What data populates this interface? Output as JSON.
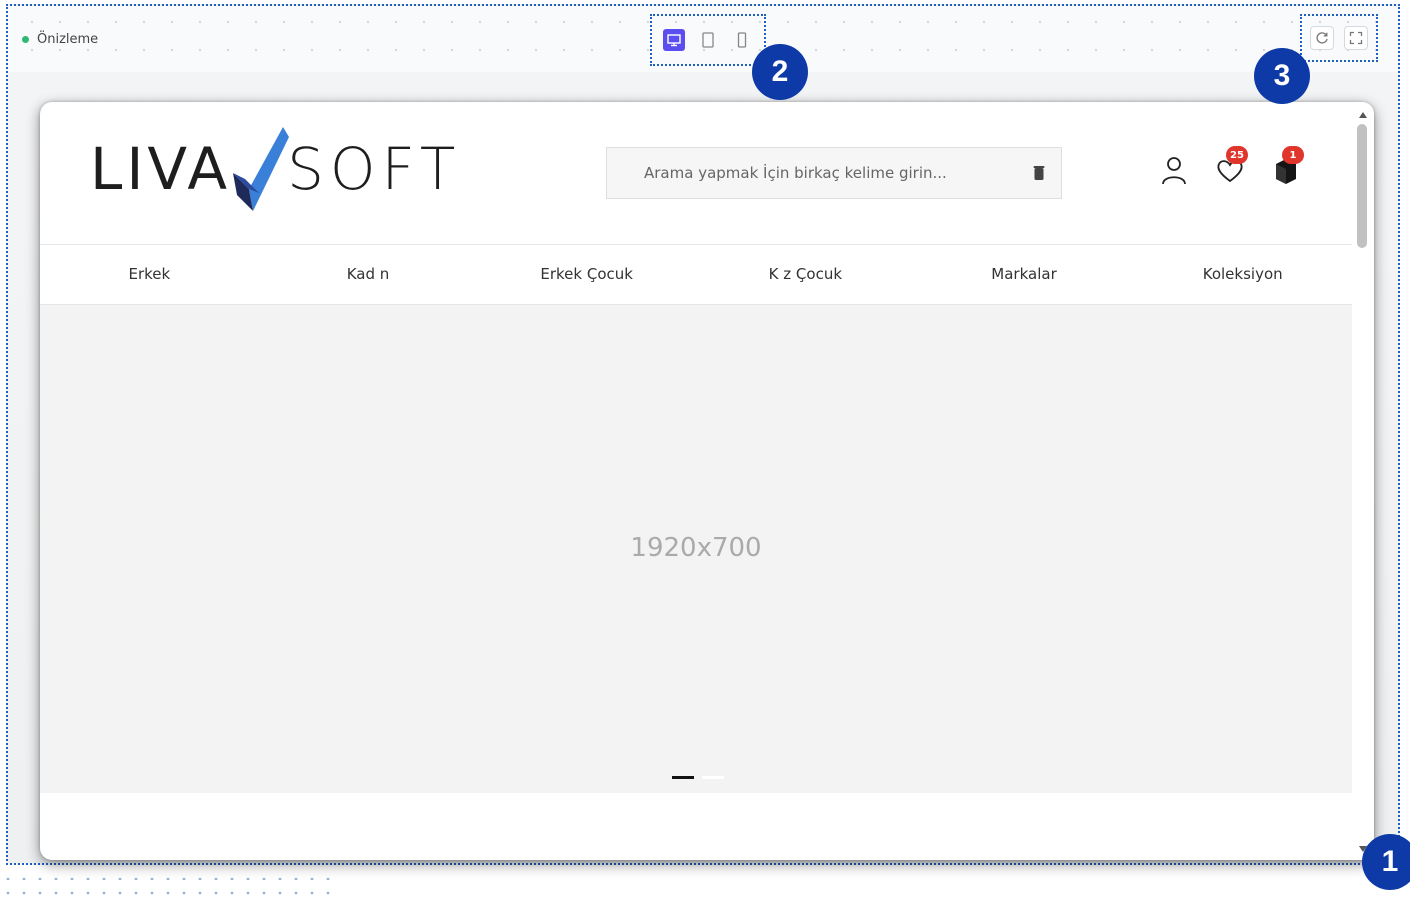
{
  "toolbar": {
    "status_label": "Önizleme",
    "devices": [
      {
        "name": "desktop",
        "icon": "monitor-icon",
        "active": true
      },
      {
        "name": "tablet",
        "icon": "tablet-icon",
        "active": false
      },
      {
        "name": "mobile",
        "icon": "phone-icon",
        "active": false
      }
    ],
    "actions": [
      {
        "name": "refresh",
        "icon": "refresh-icon"
      },
      {
        "name": "fullscreen",
        "icon": "fullscreen-icon"
      }
    ]
  },
  "markers": {
    "one": "1",
    "two": "2",
    "three": "3"
  },
  "site": {
    "logo": {
      "left": "LIVA",
      "right": "SOFT"
    },
    "search": {
      "placeholder": "Arama yapmak İçin birkaç kelime girin..."
    },
    "favorites_count": "25",
    "cart_count": "1",
    "nav": [
      "Erkek",
      "Kad n",
      "Erkek Çocuk",
      "K z Çocuk",
      "Markalar",
      "Koleksiyon"
    ],
    "slider": {
      "placeholder_text": "1920x700",
      "slide_count": 2,
      "active_slide": 1
    }
  },
  "colors": {
    "accent": "#5b4df0",
    "marker": "#0e3aa8",
    "status_dot": "#2eb872",
    "badge": "#e0352b",
    "frame_border": "#1f5fbf"
  }
}
